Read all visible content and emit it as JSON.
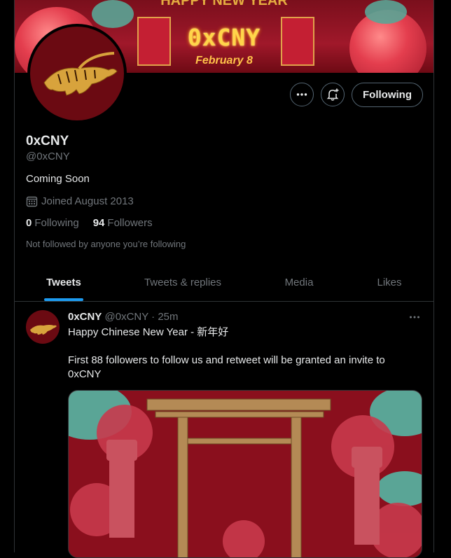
{
  "banner": {
    "top_text": "HAPPY NEW YEAR",
    "title": "0xCNY",
    "subtitle": "February 8"
  },
  "profile": {
    "name": "0xCNY",
    "handle": "@0xCNY",
    "bio": "Coming Soon",
    "joined": "Joined August 2013",
    "following_count": "0",
    "following_label": "Following",
    "followers_count": "94",
    "followers_label": "Followers",
    "not_followed": "Not followed by anyone you’re following"
  },
  "actions": {
    "more_icon": "more-icon",
    "bell_icon": "notification-bell-icon",
    "follow_label": "Following"
  },
  "tabs": [
    {
      "label": "Tweets",
      "active": true
    },
    {
      "label": "Tweets & replies",
      "active": false
    },
    {
      "label": "Media",
      "active": false
    },
    {
      "label": "Likes",
      "active": false
    }
  ],
  "tweet": {
    "name": "0xCNY",
    "meta": "@0xCNY · 25m",
    "line1": "Happy Chinese New Year - 新年好",
    "line2": "First 88 followers to follow us and retweet will be granted an invite to 0xCNY"
  },
  "colors": {
    "accent": "#1d9bf0",
    "background": "#000000",
    "muted": "#71767b",
    "border": "#2f3336"
  }
}
